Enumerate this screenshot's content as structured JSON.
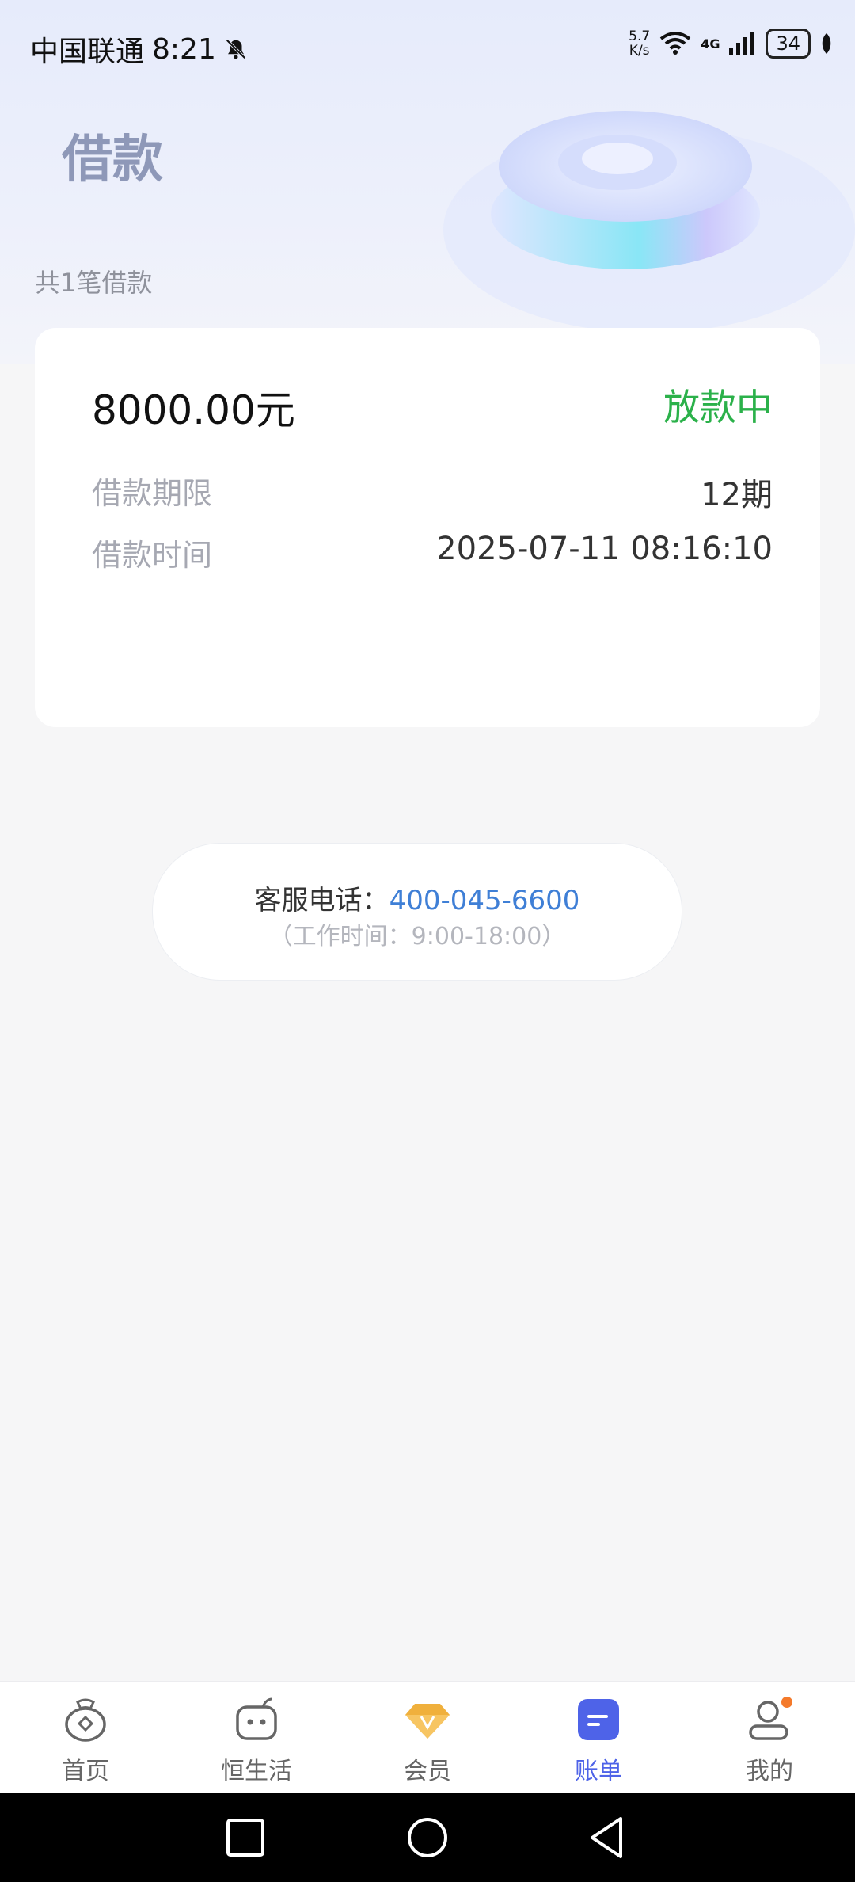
{
  "status_bar": {
    "carrier": "中国联通",
    "time": "8:21",
    "net_speed_value": "5.7",
    "net_speed_unit": "K/s",
    "network": "4G",
    "battery": "34"
  },
  "page": {
    "title": "借款",
    "loan_count": "共1笔借款"
  },
  "loan": {
    "amount": "8000.00元",
    "status": "放款中",
    "term_label": "借款期限",
    "term_value": "12期",
    "time_label": "借款时间",
    "time_value": "2025-07-11 08:16:10"
  },
  "service": {
    "label": "客服电话：",
    "phone": "400-045-6600",
    "hours": "（工作时间：9:00-18:00）"
  },
  "tabs": [
    {
      "label": "首页",
      "icon": "money-bag-icon",
      "active": false
    },
    {
      "label": "恒生活",
      "icon": "robot-face-icon",
      "active": false
    },
    {
      "label": "会员",
      "icon": "diamond-icon",
      "active": false
    },
    {
      "label": "账单",
      "icon": "bill-icon",
      "active": true
    },
    {
      "label": "我的",
      "icon": "user-icon",
      "active": false
    }
  ],
  "colors": {
    "accent": "#4e63e8",
    "status_green": "#2bb14a",
    "phone_blue": "#3f7fd6",
    "member_gold": "#f0b03c",
    "notification_dot": "#f47a2b"
  }
}
